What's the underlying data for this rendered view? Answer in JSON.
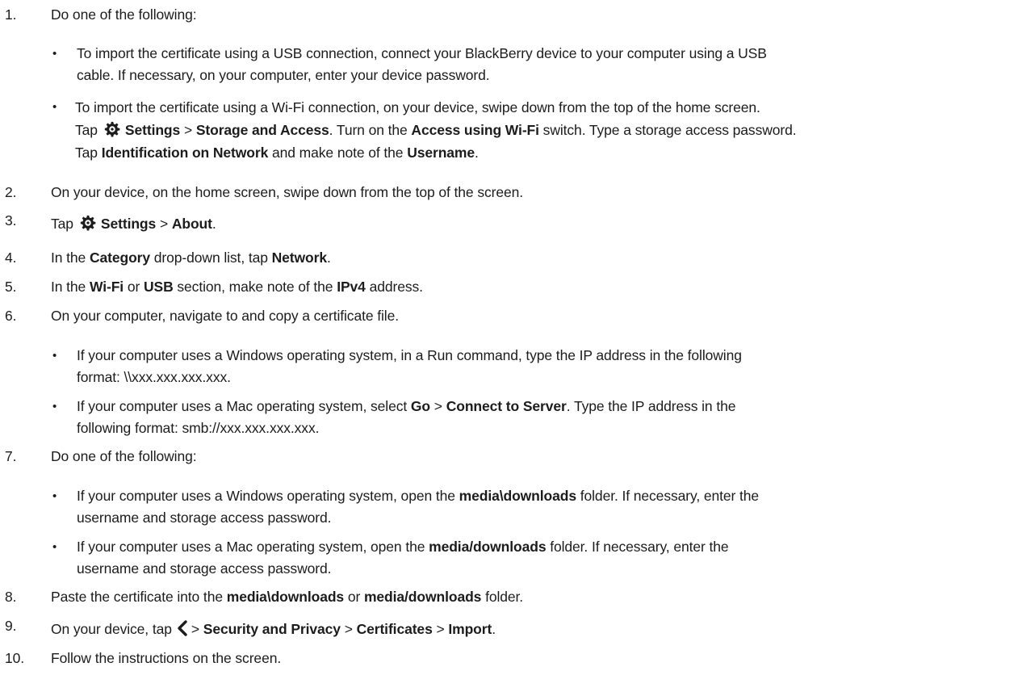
{
  "steps": [
    {
      "num": "1.",
      "text": "Do one of the following:"
    },
    {
      "num": "2.",
      "text": "On your device, on the home screen, swipe down from the top of the screen."
    },
    {
      "num": "3.",
      "pre": "Tap",
      "settings": "Settings",
      "sep": ">",
      "about": "About",
      "end": "."
    },
    {
      "num": "4.",
      "pre": "In the",
      "category": "Category",
      "mid": "drop-down list, tap",
      "network": "Network",
      "end": "."
    },
    {
      "num": "5.",
      "pre": "In the",
      "wifi": "Wi-Fi",
      "or": "or",
      "usb": "USB",
      "mid": "section, make note of the",
      "ipv4": "IPv4",
      "end": "address."
    },
    {
      "num": "6.",
      "text": "On your computer, navigate to and copy a certificate file."
    },
    {
      "num": "7.",
      "text": "Do one of the following:"
    },
    {
      "num": "8.",
      "pre": "Paste the certificate into the",
      "f1": "media\\downloads",
      "or": "or",
      "f2": "media/downloads",
      "end": "folder."
    },
    {
      "num": "9.",
      "pre": "On your device, tap",
      "sep1": ">",
      "sp": "Security and Privacy",
      "sep2": ">",
      "certs": "Certificates",
      "sep3": ">",
      "imp": "Import",
      "end": "."
    },
    {
      "num": "10.",
      "text": "Follow the instructions on the screen."
    }
  ],
  "step1": {
    "b1": {
      "l1": "To import the certificate using a USB connection, connect your BlackBerry device to your computer using a USB",
      "l2": "cable. If necessary, on your computer, enter your device password."
    },
    "b2": {
      "l1": "To import the certificate using a Wi-Fi connection, on your device, swipe down from the top of the home screen.",
      "tap": "Tap",
      "settings": "Settings",
      "sep": ">",
      "sa": "Storage and Access",
      "t1": ". Turn on the",
      "awf": "Access using Wi-Fi",
      "t2": "switch. Type a storage access password.",
      "tap2": "Tap",
      "idn": "Identification on Network",
      "t3": "and make note of the",
      "user": "Username",
      "end": "."
    }
  },
  "step6": {
    "b1": {
      "l1": "If your computer uses a Windows operating system, in a Run command, type the IP address in the following",
      "l2": "format: \\\\xxx.xxx.xxx.xxx."
    },
    "b2": {
      "pre": "If your computer uses a Mac operating system, select",
      "go": "Go",
      "sep": ">",
      "cts": "Connect to Server",
      "post": ". Type the IP address in the",
      "l2": "following format: smb://xxx.xxx.xxx.xxx."
    }
  },
  "step7": {
    "b1": {
      "pre": "If your computer uses a Windows operating system, open the",
      "folder": "media\\downloads",
      "post": "folder. If necessary, enter the",
      "l2": "username and storage access password."
    },
    "b2": {
      "pre": "If your computer uses a Mac operating system, open the",
      "folder": "media/downloads",
      "post": "folder. If necessary, enter the",
      "l2": "username and storage access password."
    }
  },
  "bullet_char": "•",
  "icons": {
    "settings": "gear-icon",
    "back": "chevron-left-icon"
  }
}
